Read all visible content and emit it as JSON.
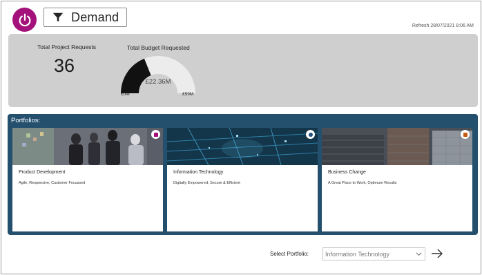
{
  "header": {
    "power_icon": "power-icon",
    "filter_icon": "filter-icon",
    "demand_label": "Demand",
    "refresh_text": "Refresh 28/07/2021 8:06 AM"
  },
  "kpis": {
    "total_requests_label": "Total Project Requests",
    "total_requests_value": "36",
    "budget_label": "Total Budget Requested",
    "budget_value": "£22.36M",
    "budget_min": "£0M",
    "budget_max": "£59M",
    "budget_fraction": 0.379
  },
  "portfolios": {
    "title": "Portfolios:",
    "cards": [
      {
        "title": "Product Development",
        "description": "Agile, Responsive, Customer Focussed",
        "badge_icon": "product-icon",
        "badge_color": "#a4117a"
      },
      {
        "title": "Information Technology",
        "description": "Digitally Empowered, Secure & Efficient",
        "badge_icon": "gear-icon",
        "badge_color": "#1f4e79"
      },
      {
        "title": "Business Change",
        "description": "A Great Place to Work, Optimum Results",
        "badge_icon": "change-icon",
        "badge_color": "#c55a11"
      }
    ]
  },
  "selector": {
    "label": "Select Portfolio:",
    "selected": "Information Technology",
    "chevron_icon": "chevron-down-icon",
    "go_icon": "arrow-right-icon"
  },
  "colors": {
    "brand": "#a4117a",
    "panel": "#cfcfcf",
    "portfolio_panel": "#24506e",
    "gauge_fill": "#111111",
    "gauge_track": "#ececec"
  }
}
